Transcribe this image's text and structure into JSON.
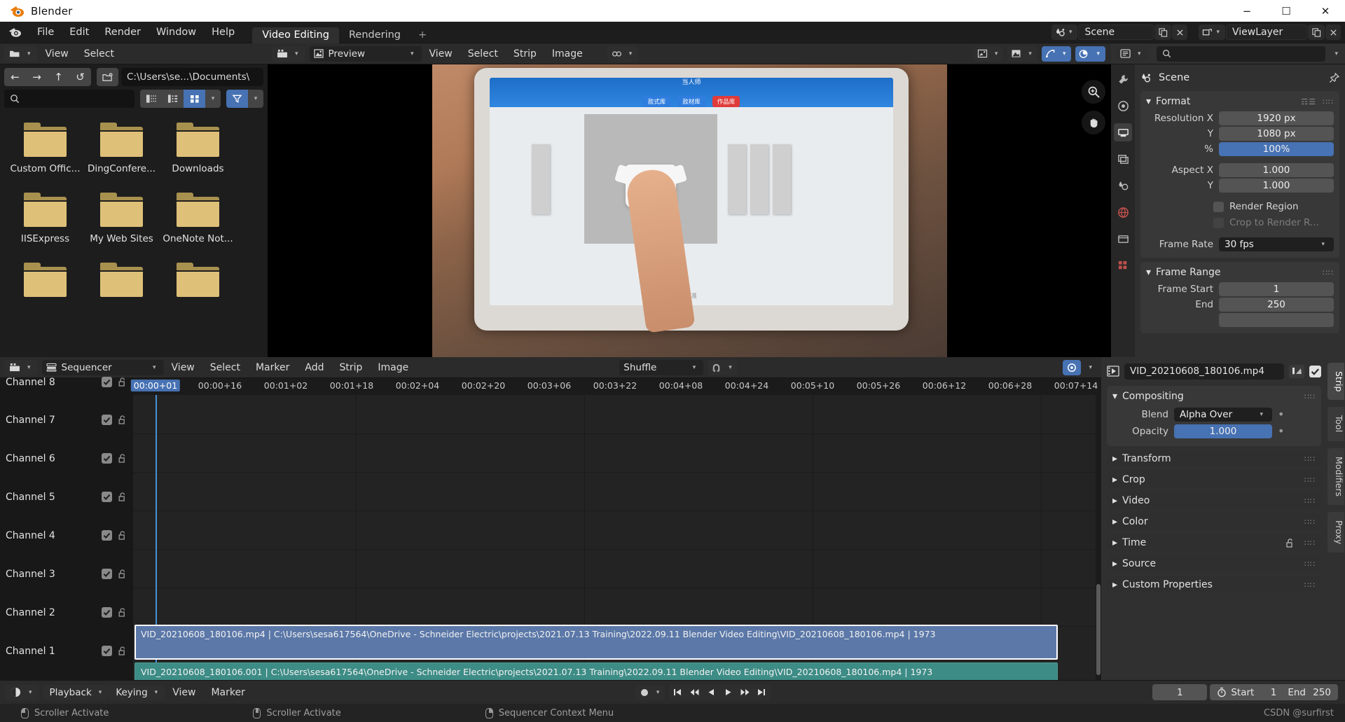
{
  "window": {
    "title": "Blender",
    "logo_icon": "blender-logo-icon",
    "minimize_label": "−",
    "maximize_label": "☐",
    "close_label": "✕"
  },
  "topbar": {
    "app_icon": "blender-icon",
    "menus": [
      "File",
      "Edit",
      "Render",
      "Window",
      "Help"
    ],
    "workspaces": [
      {
        "label": "Video Editing",
        "active": true
      },
      {
        "label": "Rendering",
        "active": false
      }
    ],
    "add_workspace_label": "+",
    "scene": {
      "icon": "scene-icon",
      "name": "Scene",
      "new_icon": "duplicate-icon",
      "unlink_icon": "x-icon"
    },
    "viewlayer": {
      "icon": "viewlayer-icon",
      "name": "ViewLayer",
      "new_icon": "duplicate-icon",
      "remove_icon": "x-icon"
    }
  },
  "file_browser": {
    "editor_icon": "file-browser-editor-icon",
    "menus": [
      "View",
      "Select"
    ],
    "nav": {
      "back_icon": "arrow-left-icon",
      "forward_icon": "arrow-right-icon",
      "up_icon": "arrow-up-icon",
      "refresh_icon": "refresh-icon",
      "new_folder_icon": "new-folder-icon"
    },
    "path_value": "C:\\Users\\se...\\Documents\\",
    "search_placeholder": "",
    "search_icon": "search-icon",
    "display_modes": [
      {
        "icon": "list-vertical-icon",
        "active": false
      },
      {
        "icon": "list-detail-icon",
        "active": false
      },
      {
        "icon": "thumbnail-grid-icon",
        "active": true
      }
    ],
    "filter_icon": "filter-icon",
    "filter_active": true,
    "items": [
      {
        "name": "Custom Offic...",
        "icon": "folder-icon"
      },
      {
        "name": "DingConfere...",
        "icon": "folder-icon"
      },
      {
        "name": "Downloads",
        "icon": "folder-icon"
      },
      {
        "name": "IISExpress",
        "icon": "folder-icon"
      },
      {
        "name": "My Web Sites",
        "icon": "folder-icon"
      },
      {
        "name": "OneNote Not...",
        "icon": "folder-icon"
      }
    ]
  },
  "preview": {
    "editor_icon": "sequencer-editor-icon",
    "view_type": "Preview",
    "menus": [
      "View",
      "Select",
      "Strip",
      "Image"
    ],
    "gizmo_icon": "gizmo-icon",
    "header_toggles": [
      {
        "icon": "overlay-image-icon",
        "active": false
      },
      {
        "icon": "display-channel-icon",
        "active": false
      },
      {
        "icon": "gizmo-toggle-icon",
        "active": true
      },
      {
        "icon": "overlays-toggle-icon",
        "active": true
      }
    ],
    "side_tools": [
      {
        "icon": "zoom-icon"
      },
      {
        "icon": "pan-hand-icon"
      }
    ],
    "tablet_ui": {
      "title": "当人师",
      "buttons": [
        "款式库",
        "款材库",
        "作品库"
      ],
      "caption": "校准"
    }
  },
  "properties": {
    "tabs": [
      {
        "icon": "tool-icon",
        "active": false
      },
      {
        "icon": "render-icon",
        "active": false
      },
      {
        "icon": "output-icon",
        "active": true
      },
      {
        "icon": "view-layer-icon",
        "active": false
      },
      {
        "icon": "scene-props-icon",
        "active": false
      },
      {
        "icon": "world-icon",
        "active": false
      },
      {
        "icon": "collection-icon",
        "active": false
      },
      {
        "icon": "texture-icon",
        "active": false
      }
    ],
    "editor_icon": "properties-editor-icon",
    "search_icon": "search-icon",
    "breadcrumb_icon": "scene-icon",
    "breadcrumb": "Scene",
    "pin_icon": "pin-icon",
    "panels": [
      {
        "title": "Format",
        "expanded": true,
        "rows": [
          {
            "label": "Resolution X",
            "value": "1920 px",
            "type": "number"
          },
          {
            "label": "Y",
            "value": "1080 px",
            "type": "number"
          },
          {
            "label": "%",
            "value": "100%",
            "type": "slider"
          },
          {
            "label": "Aspect X",
            "value": "1.000",
            "type": "number"
          },
          {
            "label": "Y",
            "value": "1.000",
            "type": "number"
          },
          {
            "label": "",
            "value": "Render Region",
            "type": "checkbox",
            "checked": false
          },
          {
            "label": "",
            "value": "Crop to Render R...",
            "type": "checkbox",
            "checked": false,
            "disabled": true
          },
          {
            "label": "Frame Rate",
            "value": "30 fps",
            "type": "dropdown"
          }
        ]
      },
      {
        "title": "Frame Range",
        "expanded": true,
        "rows": [
          {
            "label": "Frame Start",
            "value": "1",
            "type": "number"
          },
          {
            "label": "End",
            "value": "250",
            "type": "number"
          }
        ]
      }
    ]
  },
  "sequencer": {
    "editor_icon": "sequencer-editor-icon",
    "view_type": "Sequencer",
    "menus": [
      "View",
      "Select",
      "Marker",
      "Add",
      "Strip",
      "Image"
    ],
    "overlap_mode": "Shuffle",
    "snap_icon": "snap-magnet-icon",
    "channels": [
      {
        "label": "Channel 8",
        "visible": true,
        "locked": false
      },
      {
        "label": "Channel 7",
        "visible": true,
        "locked": false
      },
      {
        "label": "Channel 6",
        "visible": true,
        "locked": false
      },
      {
        "label": "Channel 5",
        "visible": true,
        "locked": false
      },
      {
        "label": "Channel 4",
        "visible": true,
        "locked": false
      },
      {
        "label": "Channel 3",
        "visible": true,
        "locked": false
      },
      {
        "label": "Channel 2",
        "visible": true,
        "locked": false
      },
      {
        "label": "Channel 1",
        "visible": true,
        "locked": false
      }
    ],
    "current_frame_label": "00:00+01",
    "ruler_ticks": [
      "00:00+16",
      "00:01+02",
      "00:01+18",
      "00:02+04",
      "00:02+20",
      "00:03+06",
      "00:03+22",
      "00:04+08",
      "00:04+24",
      "00:05+10",
      "00:05+26",
      "00:06+12",
      "00:06+28",
      "00:07+14"
    ],
    "strips": [
      {
        "label": "VID_20210608_180106.mp4 | C:\\Users\\sesa617564\\OneDrive - Schneider Electric\\projects\\2021.07.13 Training\\2022.09.11 Blender Video Editing\\VID_20210608_180106.mp4 | 1973",
        "channel": 2,
        "color": "#5b78a8",
        "selected": true
      },
      {
        "label": "VID_20210608_180106.001 | C:\\Users\\sesa617564\\OneDrive - Schneider Electric\\projects\\2021.07.13 Training\\2022.09.11 Blender Video Editing\\VID_20210608_180106.mp4 | 1973",
        "channel": 1,
        "color": "#3d8c86",
        "selected": false
      }
    ]
  },
  "strip_panel": {
    "filmstrip_icon": "filmstrip-icon",
    "name": "VID_20210608_180106.mp4",
    "color_tag_icon": "color-tag-icon",
    "mute_checked": true,
    "tabs": [
      {
        "label": "Strip",
        "active": true
      },
      {
        "label": "Tool",
        "active": false
      },
      {
        "label": "Modifiers",
        "active": false
      },
      {
        "label": "Proxy",
        "active": false
      }
    ],
    "compositing": {
      "title": "Compositing",
      "expanded": true,
      "blend_label": "Blend",
      "blend_value": "Alpha Over",
      "opacity_label": "Opacity",
      "opacity_value": "1.000"
    },
    "sections": [
      {
        "title": "Transform",
        "expanded": false
      },
      {
        "title": "Crop",
        "expanded": false
      },
      {
        "title": "Video",
        "expanded": false
      },
      {
        "title": "Color",
        "expanded": false
      },
      {
        "title": "Time",
        "expanded": false,
        "lock_icon": "unlock-icon"
      },
      {
        "title": "Source",
        "expanded": false
      },
      {
        "title": "Custom Properties",
        "expanded": false
      }
    ]
  },
  "timeline": {
    "editor_icon": "timeline-editor-icon",
    "menus": [
      "Playback",
      "Keying",
      "View",
      "Marker"
    ],
    "keying_set_icon": "record-dot-icon",
    "transport": [
      {
        "icon": "jump-start-icon"
      },
      {
        "icon": "prev-keyframe-icon"
      },
      {
        "icon": "play-reverse-icon"
      },
      {
        "icon": "play-icon"
      },
      {
        "icon": "next-keyframe-icon"
      },
      {
        "icon": "jump-end-icon"
      }
    ],
    "current_frame": "1",
    "timer_icon": "stopwatch-icon",
    "start_label": "Start",
    "start_value": "1",
    "end_label": "End",
    "end_value": "250"
  },
  "status_bar": {
    "items": [
      {
        "mouse": "left",
        "label": "Scroller Activate"
      },
      {
        "mouse": "middle",
        "label": "Scroller Activate"
      },
      {
        "mouse": "right",
        "label": "Sequencer Context Menu"
      }
    ],
    "watermark": "CSDN @surfirst"
  },
  "colors": {
    "accent_blue": "#4772b3",
    "strip_blue": "#5b78a8",
    "strip_teal": "#3d8c86",
    "folder_yellow": "#dfc078",
    "panel_bg": "#303030",
    "editor_bg": "#1d1d1d"
  }
}
